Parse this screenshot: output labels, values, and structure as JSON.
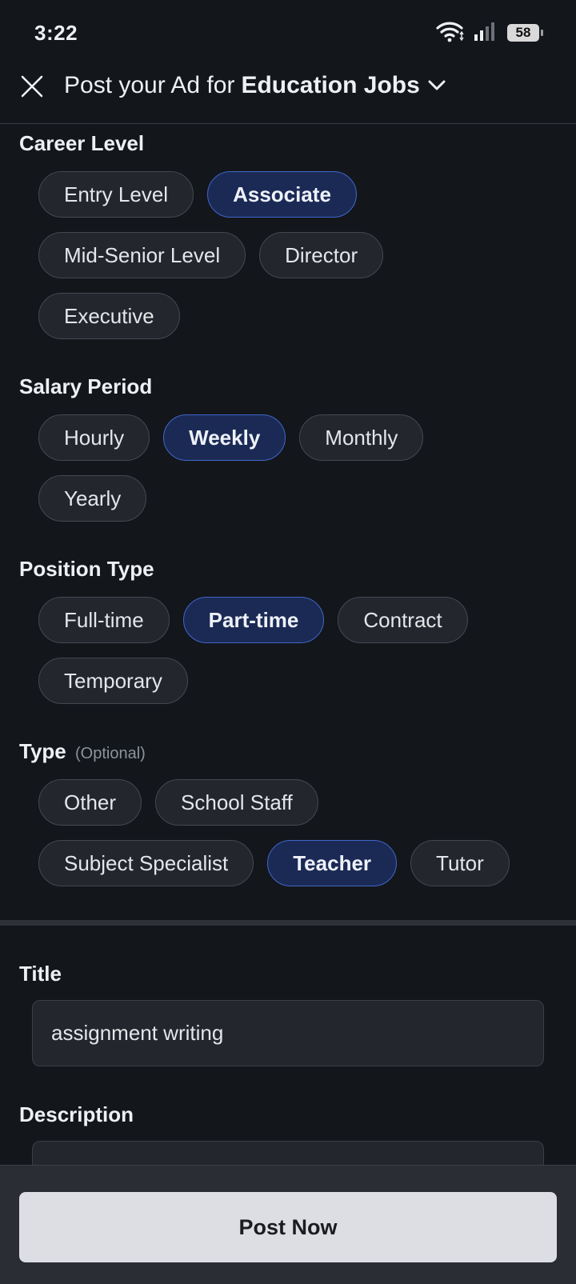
{
  "status_bar": {
    "time": "3:22",
    "battery": "58",
    "icons": [
      "wifi-icon",
      "signal-icon",
      "battery-icon"
    ]
  },
  "header": {
    "title_prefix": "Post your Ad for",
    "category": "Education Jobs",
    "close_icon": "close-icon",
    "dropdown_icon": "chevron-down-icon"
  },
  "career_level": {
    "label": "Career Level",
    "options": [
      "Entry Level",
      "Associate",
      "Mid-Senior Level",
      "Director",
      "Executive"
    ],
    "selected": "Associate"
  },
  "salary_period": {
    "label": "Salary Period",
    "options": [
      "Hourly",
      "Weekly",
      "Monthly",
      "Yearly"
    ],
    "selected": "Weekly"
  },
  "position_type": {
    "label": "Position Type",
    "options": [
      "Full-time",
      "Part-time",
      "Contract",
      "Temporary"
    ],
    "selected": "Part-time"
  },
  "type": {
    "label": "Type",
    "optional_label": "(Optional)",
    "options": [
      "Other",
      "School Staff",
      "Subject Specialist",
      "Teacher",
      "Tutor"
    ],
    "selected": "Teacher"
  },
  "title_field": {
    "label": "Title",
    "value": "assignment writing"
  },
  "description_field": {
    "label": "Description"
  },
  "footer": {
    "post_button": "Post Now"
  },
  "colors": {
    "background": "#13161b",
    "chip_bg": "#23262c",
    "chip_selected_bg": "#1b2a55",
    "chip_selected_border": "#3f66c9",
    "button_bg": "#dcdee3"
  }
}
